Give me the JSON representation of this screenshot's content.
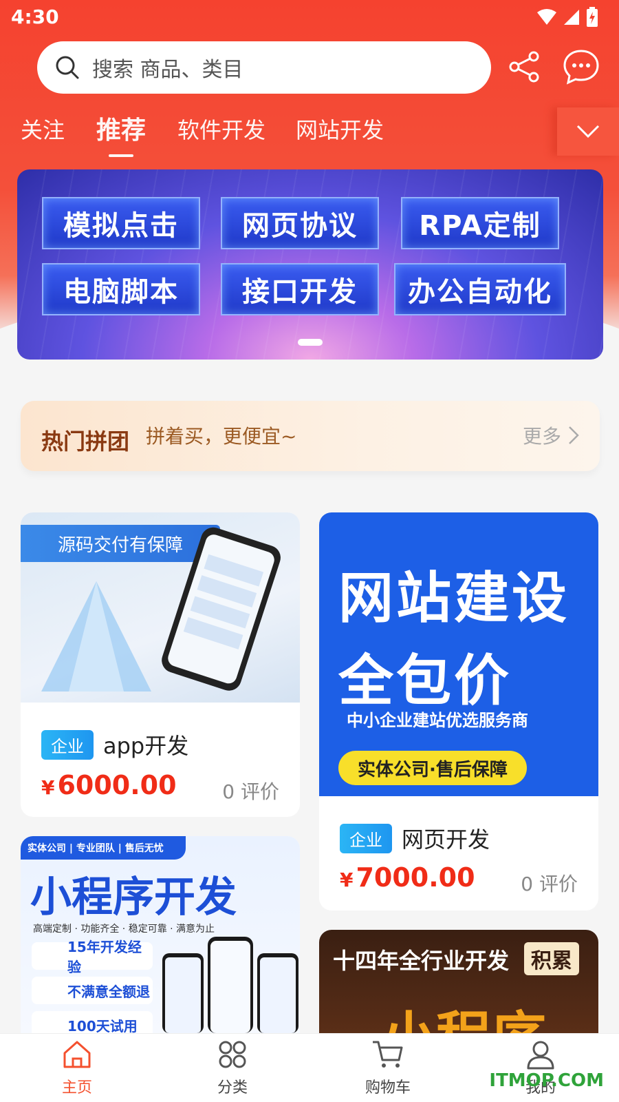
{
  "status_bar": {
    "time": "4:30"
  },
  "search": {
    "placeholder": "搜索 商品、类目"
  },
  "tabs": [
    {
      "label": "关注"
    },
    {
      "label": "推荐",
      "active": true
    },
    {
      "label": "软件开发"
    },
    {
      "label": "网站开发"
    }
  ],
  "banner": {
    "cells": [
      "模拟点击",
      "网页协议",
      "RPA定制",
      "电脑脚本",
      "接口开发",
      "办公自动化"
    ]
  },
  "group_buy": {
    "title": "热门拼团",
    "subtitle": "拼着买，更便宜~",
    "more_label": "更多"
  },
  "products": [
    {
      "image_texts": [
        "源码交付有保障"
      ],
      "tag": "企业",
      "title": "app开发",
      "currency": "¥",
      "price": "6000.00",
      "reviews": "0 评价"
    },
    {
      "image_texts": [
        "网站建设",
        "全包价",
        "中小企业建站优选服务商",
        "实体公司·售后保障"
      ],
      "tag": "企业",
      "title": "网页开发",
      "currency": "¥",
      "price": "7000.00",
      "reviews": "0 评价"
    },
    {
      "image_texts": [
        "实体公司 | 专业团队 | 售后无忧",
        "小程序开发",
        "高端定制 · 功能齐全 · 稳定可靠 · 满意为止",
        "15年开发经验",
        "不满意全额退",
        "100天试用"
      ]
    },
    {
      "image_texts": [
        "十四年全行业开发",
        "积累",
        "小程序"
      ]
    }
  ],
  "bottom_nav": [
    {
      "label": "主页",
      "icon": "home-icon",
      "active": true
    },
    {
      "label": "分类",
      "icon": "category-icon"
    },
    {
      "label": "购物车",
      "icon": "cart-icon"
    },
    {
      "label": "我的",
      "icon": "user-icon"
    }
  ],
  "watermark": "ITMOP.COM",
  "colors": {
    "brand_red": "#f4412d",
    "price_red": "#f02c17",
    "tag_blue": "#1e96f0",
    "nav_active": "#f4502e"
  }
}
